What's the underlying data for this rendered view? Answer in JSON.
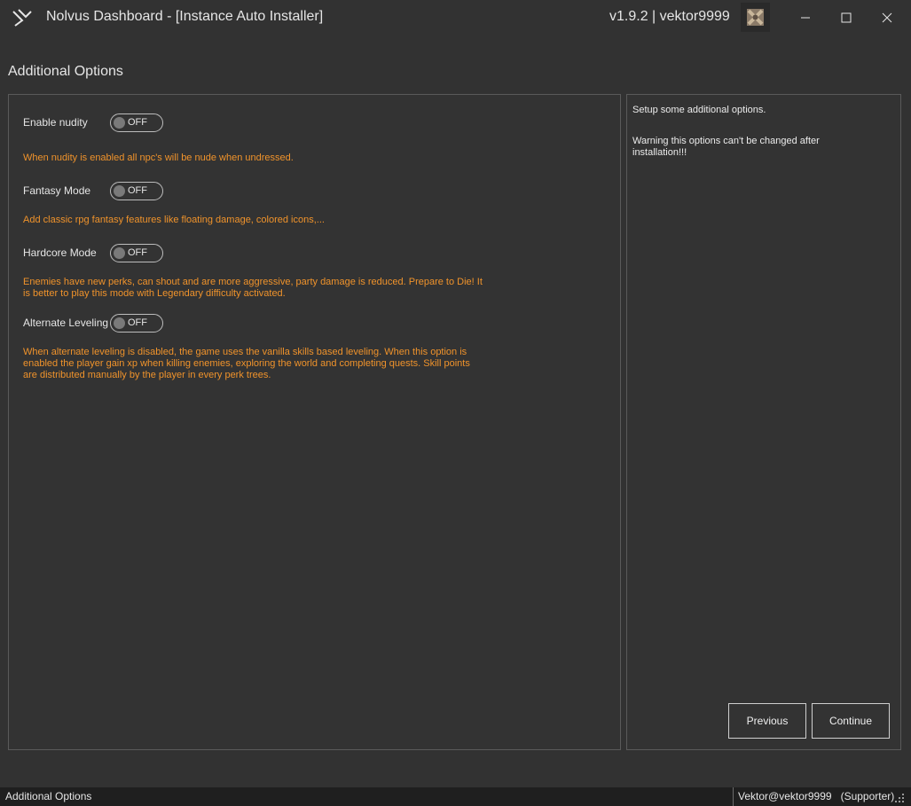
{
  "titlebar": {
    "app_icon": "nolvus-logo-icon",
    "title": "Nolvus Dashboard - [Instance Auto Installer]",
    "version_user": "v1.9.2 | vektor9999",
    "avatar_icon": "user-avatar",
    "controls": [
      "minimize-icon",
      "maximize-icon",
      "close-icon"
    ]
  },
  "page": {
    "title": "Additional Options"
  },
  "options": [
    {
      "label": "Enable nudity",
      "state": "OFF",
      "description": "When nudity is enabled all npc's will be nude when undressed."
    },
    {
      "label": "Fantasy Mode",
      "state": "OFF",
      "description": "Add classic rpg fantasy features like floating damage, colored icons,..."
    },
    {
      "label": "Hardcore Mode",
      "state": "OFF",
      "description": "Enemies have new perks, can shout and are more aggressive, party damage is reduced. Prepare to Die! It is better to play this mode with Legendary difficulty activated."
    },
    {
      "label": "Alternate Leveling",
      "state": "OFF",
      "description": "When alternate leveling is disabled, the game uses the vanilla skills based leveling. When this option is enabled the player gain xp when killing enemies, exploring the world and completing quests. Skill points are distributed manually by the player in every perk trees."
    }
  ],
  "side": {
    "info": "Setup some additional options.",
    "warning": "Warning this options can't be changed after installation!!!",
    "previous_label": "Previous",
    "continue_label": "Continue"
  },
  "status": {
    "left": "Additional Options",
    "right": "Vektor@vektor9999   (Supporter)"
  },
  "colors": {
    "background": "#323232",
    "accent_orange": "#f0932b",
    "status_bar": "#1f1f1f"
  }
}
